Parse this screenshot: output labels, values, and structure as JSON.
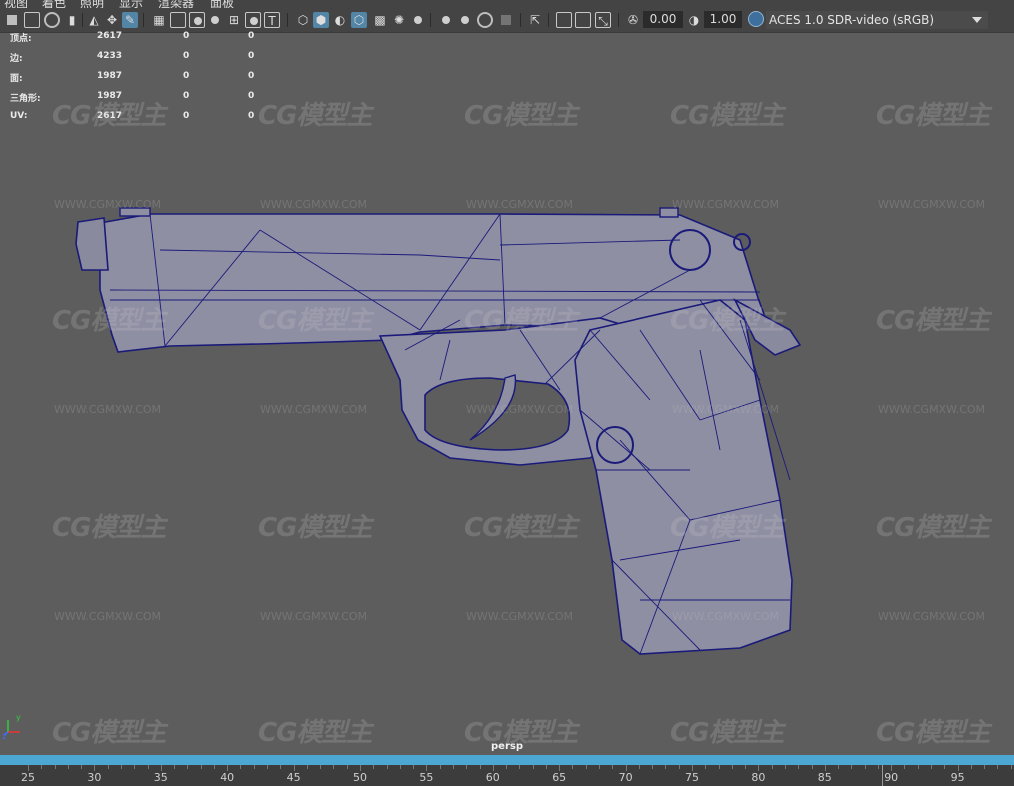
{
  "menu": {
    "items": [
      "视图",
      "着色",
      "照明",
      "显示",
      "渲染器",
      "面板"
    ]
  },
  "toolbar": {
    "value_a": "0.00",
    "value_b": "1.00",
    "color_space": "ACES 1.0 SDR-video (sRGB)",
    "icons": [
      "camera-select-icon",
      "camera-lock-icon",
      "camera-attributes-icon",
      "bookmark-icon",
      "image-plane-icon",
      "grease-pencil-icon",
      "grid-icon",
      "film-gate-icon",
      "resolution-gate-icon",
      "gate-mask-icon",
      "field-chart-icon",
      "safe-action-icon",
      "safe-title-icon",
      "wireframe-icon",
      "smooth-shade-icon",
      "default-material-icon",
      "wireframe-on-shaded-icon",
      "textured-icon",
      "lights-icon",
      "shadows-icon",
      "screen-space-ao-icon",
      "motion-blur-icon",
      "anti-aliasing-icon",
      "depth-of-field-icon",
      "isolate-select-icon",
      "xray-icon",
      "xray-joints-icon",
      "backface-icon",
      "exposure-icon",
      "gamma-icon",
      "color-management-icon"
    ]
  },
  "hud": {
    "rows": [
      {
        "label": "顶点:",
        "value": "2617",
        "sel": "0",
        "comp": "0"
      },
      {
        "label": "边:",
        "value": "4233",
        "sel": "0",
        "comp": "0"
      },
      {
        "label": "面:",
        "value": "1987",
        "sel": "0",
        "comp": "0"
      },
      {
        "label": "三角形:",
        "value": "1987",
        "sel": "0",
        "comp": "0"
      },
      {
        "label": "UV:",
        "value": "2617",
        "sel": "0",
        "comp": "0"
      }
    ]
  },
  "watermark": {
    "logo": "CG模型主",
    "url": "WWW.CGMXW.COM"
  },
  "viewport": {
    "camera_label": "persp",
    "axis_y": "y",
    "axis_z": "z",
    "axis_x": "x",
    "model_fill": "#8f8fa3",
    "wire_color": "#1a1a7a"
  },
  "timeline": {
    "accent": "#4da7d3",
    "labels": [
      "25",
      "30",
      "35",
      "40",
      "45",
      "50",
      "55",
      "60",
      "65",
      "70",
      "75",
      "80",
      "85",
      "90",
      "95"
    ]
  }
}
